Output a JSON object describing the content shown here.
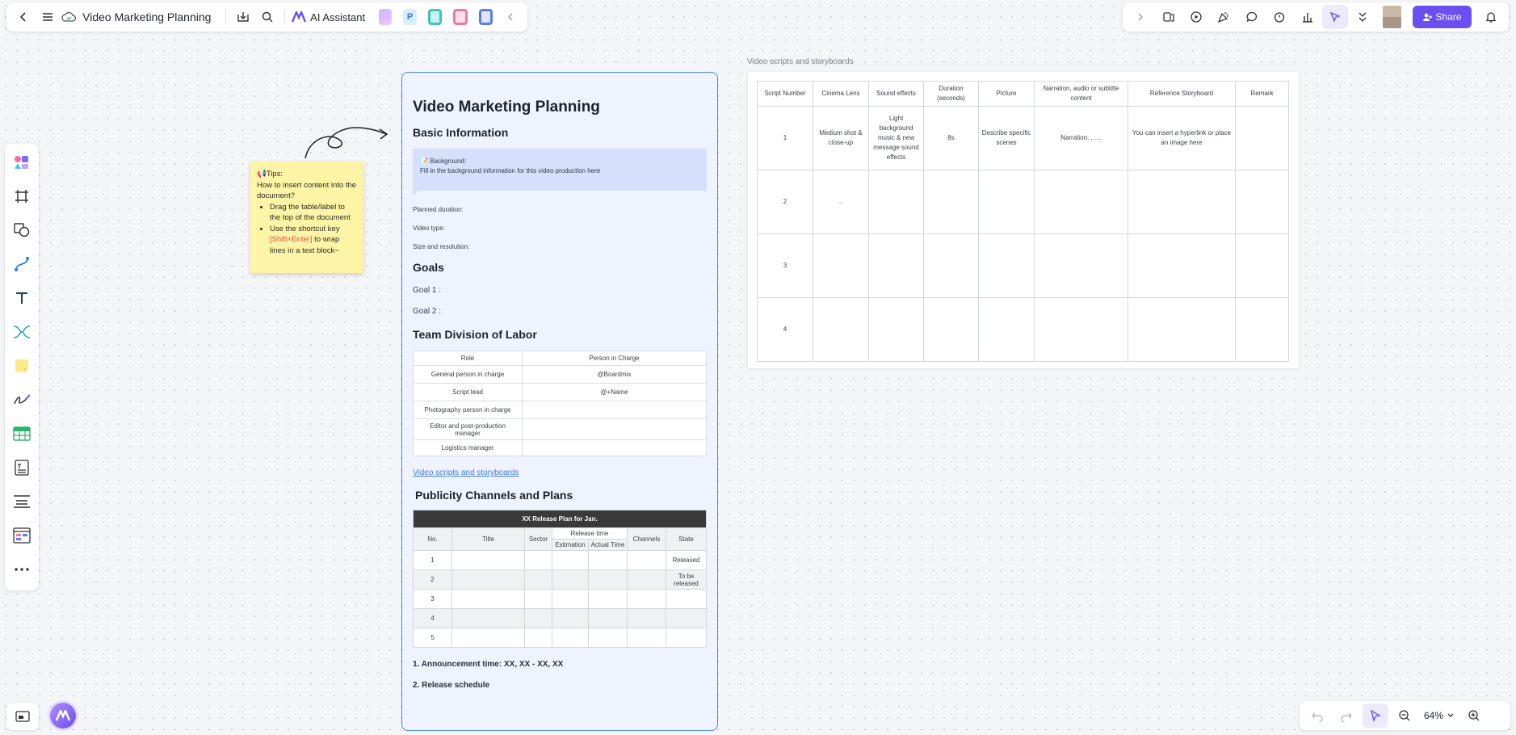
{
  "window": {
    "title": "Video Marketing Planning"
  },
  "toolbar": {
    "ai_assistant": "AI Assistant"
  },
  "share": {
    "label": "Share"
  },
  "zoom": {
    "level": "64%"
  },
  "sticky": {
    "heading": "Tips:",
    "line1": "How to insert content into the document?",
    "bullet1": "Drag the table/label to the top of the document",
    "bullet2_pre": "Use the shortcut key ",
    "bullet2_key": "[Shift+Enter]",
    "bullet2_post": " to wrap lines in a text block~"
  },
  "doc": {
    "title": "Video Marketing Planning",
    "basic_info": "Basic Information",
    "background_label": "Background:",
    "background_text": "Fill in the background information for this video production here",
    "planned_duration": "Planned duration:",
    "video_type": "Video type:",
    "size_resolution": "Size and resolution:",
    "goals_heading": "Goals",
    "goal1": "Goal 1 :",
    "goal2": "Goal 2 :",
    "team_heading": "Team Division of Labor",
    "team_headers": [
      "Role",
      "Person in Charge"
    ],
    "team_rows": [
      [
        "General person in charge",
        "@Boardmix"
      ],
      [
        "Script lead",
        "@+Name"
      ],
      [
        "Photography person in charge",
        ""
      ],
      [
        "Editor and post-production manager",
        ""
      ],
      [
        "Logistics manager",
        ""
      ]
    ],
    "link_text": "Video scripts and storyboards",
    "publicity_heading": "Publicity Channels and Plans",
    "release_title": "XX Release Plan for Jan.",
    "release_headers": {
      "no": "No.",
      "title": "Title",
      "sector": "Sector",
      "release_time": "Release time",
      "estimation": "Estimation",
      "actual": "Actual Time",
      "channels": "Channels",
      "state": "State"
    },
    "release_rows": [
      {
        "no": "1",
        "state": "Released"
      },
      {
        "no": "2",
        "state": "To be released"
      },
      {
        "no": "3",
        "state": ""
      },
      {
        "no": "4",
        "state": ""
      },
      {
        "no": "5",
        "state": ""
      }
    ],
    "announcement": "1. Announcement time: XX, XX - XX, XX",
    "schedule": "2. Release schedule"
  },
  "storyboard": {
    "title": "Video scripts and storyboards",
    "headers": [
      "Script Number",
      "Cinema Lens",
      "Sound effects",
      "Duration (seconds)",
      "Picture",
      "Narration, audio or subtitle content",
      "Reference Storyboard",
      "Remark"
    ],
    "rows": [
      [
        "1",
        "Medium shot & close-up",
        "Light background music & new message sound effects",
        "8s",
        "Describe specific scenes",
        "Narration:  ......",
        "You can insert a hyperlink or place an image here",
        ""
      ],
      [
        "2",
        "...",
        "",
        "",
        "",
        "",
        "",
        ""
      ],
      [
        "3",
        "",
        "",
        "",
        "",
        "",
        "",
        ""
      ],
      [
        "4",
        "",
        "",
        "",
        "",
        "",
        "",
        ""
      ]
    ]
  },
  "colors": {
    "accent": "#6c4ff0",
    "doc_border": "#4a85ee",
    "doc_bg": "#eff3fd",
    "sticky": "#fdf4a5"
  }
}
